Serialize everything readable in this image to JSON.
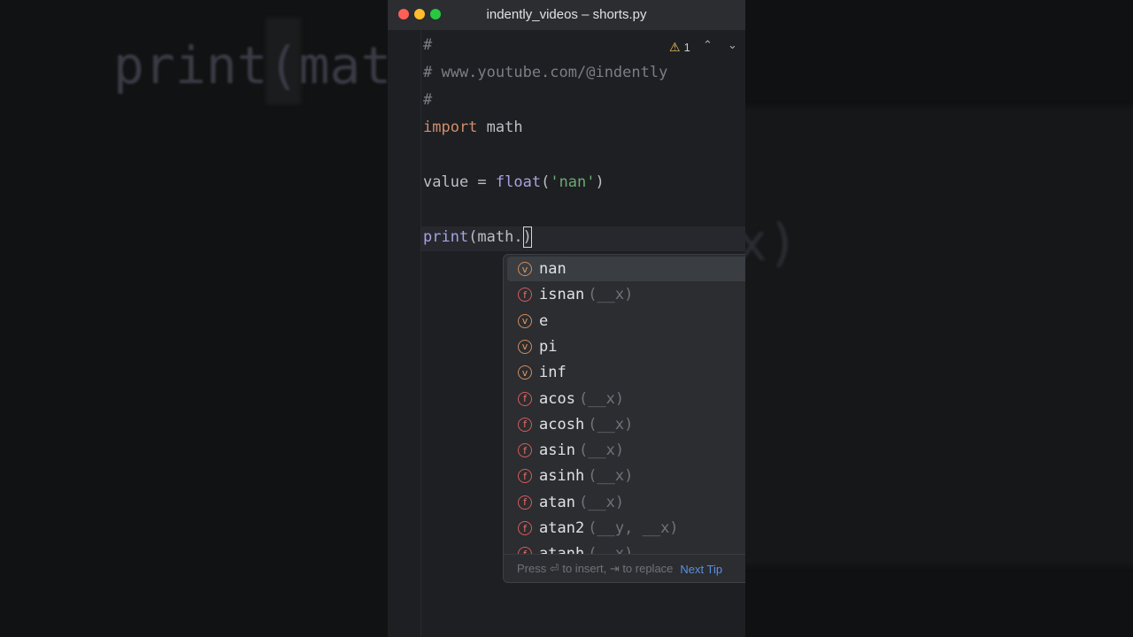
{
  "window": {
    "title": "indently_videos – shorts.py"
  },
  "background": {
    "left_ghost_text": "print(mat",
    "right_ghost_text": "x)"
  },
  "inspections": {
    "warning_count": "1",
    "up_icon": "chevron-up-icon",
    "down_icon": "chevron-down-icon"
  },
  "code": {
    "l1": "#",
    "l2": "# www.youtube.com/@indently",
    "l3": "#",
    "l4_kw": "import",
    "l4_rest": " math",
    "l6_a": "value = ",
    "l6_fn": "float",
    "l6_b": "(",
    "l6_str": "'nan'",
    "l6_c": ")",
    "l8_fn": "print",
    "l8_a": "(math.",
    "l8_caret": ")"
  },
  "completion": {
    "items": [
      {
        "kind": "v",
        "name": "nan",
        "sig": ""
      },
      {
        "kind": "f",
        "name": "isnan",
        "sig": "(__x)"
      },
      {
        "kind": "v",
        "name": "e",
        "sig": ""
      },
      {
        "kind": "v",
        "name": "pi",
        "sig": ""
      },
      {
        "kind": "v",
        "name": "inf",
        "sig": ""
      },
      {
        "kind": "f",
        "name": "acos",
        "sig": "(__x)"
      },
      {
        "kind": "f",
        "name": "acosh",
        "sig": "(__x)"
      },
      {
        "kind": "f",
        "name": "asin",
        "sig": "(__x)"
      },
      {
        "kind": "f",
        "name": "asinh",
        "sig": "(__x)"
      },
      {
        "kind": "f",
        "name": "atan",
        "sig": "(__x)"
      },
      {
        "kind": "f",
        "name": "atan2",
        "sig": "(__y, __x)"
      },
      {
        "kind": "f",
        "name": "atanh",
        "sig": "(__x)"
      }
    ],
    "footer_hint": "Press ⏎ to insert, ⇥ to replace",
    "next_tip": "Next Tip"
  },
  "colors": {
    "accent": "#5b8fe0",
    "keyword": "#cf8e6d",
    "string": "#6aab73",
    "function": "#a6a3e0"
  }
}
